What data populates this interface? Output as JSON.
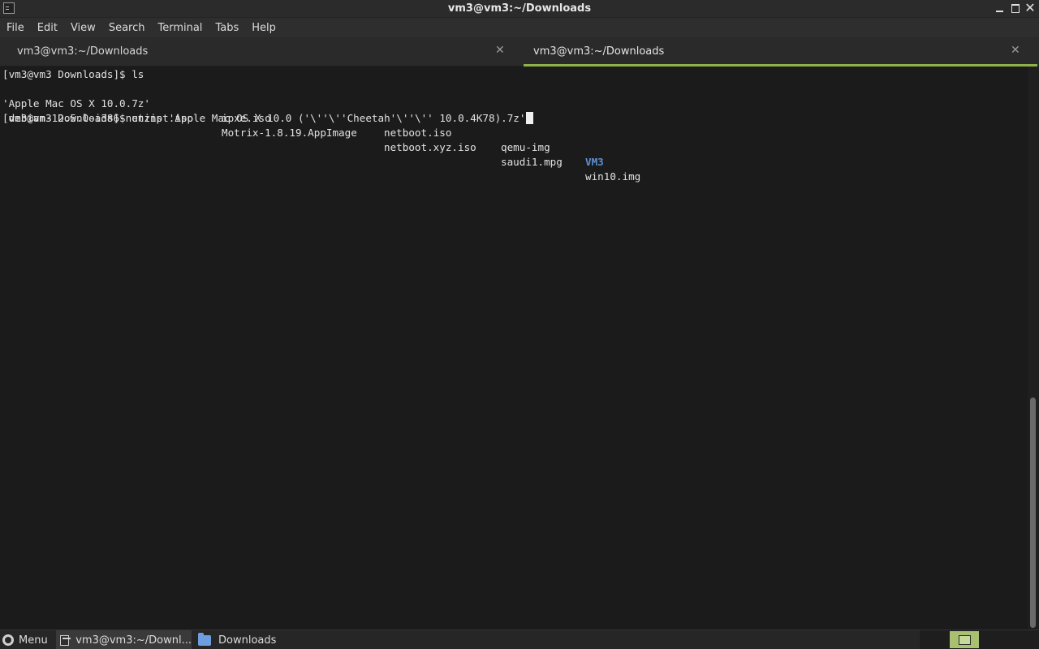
{
  "window": {
    "title": "vm3@vm3:~/Downloads",
    "minimize_icon": "minimize-icon",
    "maximize_icon": "maximize-icon",
    "close_glyph": "✕"
  },
  "menubar": {
    "items": [
      "File",
      "Edit",
      "View",
      "Search",
      "Terminal",
      "Tabs",
      "Help"
    ]
  },
  "tabs": [
    {
      "label": "vm3@vm3:~/Downloads",
      "close": "✕",
      "active": false
    },
    {
      "label": "vm3@vm3:~/Downloads",
      "close": "✕",
      "active": true
    }
  ],
  "terminal": {
    "line1": "[vm3@vm3 Downloads]$ ls",
    "ls_row1": [
      "'Apple Mac OS X 10.0.7z'",
      "ipxe.iso",
      "netboot.iso",
      "qemu-img",
      "VM3"
    ],
    "ls_row2": [
      " debian-12.5.0-i386-netinst.iso",
      "Motrix-1.8.19.AppImage",
      "netboot.xyz.iso",
      "saudi1.mpg",
      "win10.img"
    ],
    "line4": "[vm3@vm3 Downloads]$ unzip 'Apple Mac OS X 10.0 ('\\''\\''Cheetah'\\''\\'' 10.0.4K78).7z'",
    "directory_color": "#5d91d3"
  },
  "taskbar": {
    "menu_label": "Menu",
    "terminal_task": "vm3@vm3:~/Downl...",
    "files_task": "Downloads",
    "accent": "#a8c070"
  },
  "colors": {
    "background": "#1b1b1b",
    "tab_active_underline": "#8fb04a"
  }
}
